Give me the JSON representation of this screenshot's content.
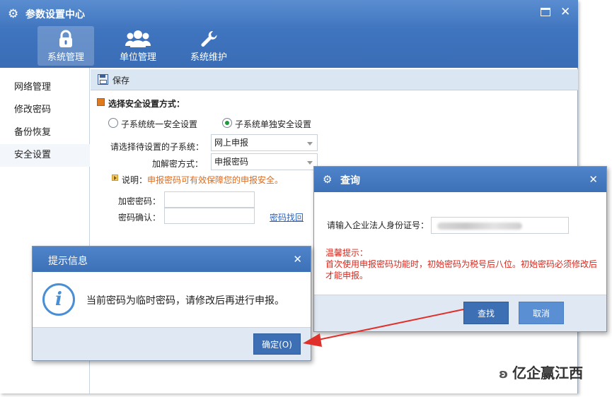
{
  "window": {
    "title": "参数设置中心"
  },
  "nav": [
    {
      "label": "系统管理",
      "icon": "lock-icon",
      "active": true
    },
    {
      "label": "单位管理",
      "icon": "users-icon",
      "active": false
    },
    {
      "label": "系统维护",
      "icon": "wrench-icon",
      "active": false
    }
  ],
  "sidebar": {
    "items": [
      {
        "label": "网络管理"
      },
      {
        "label": "修改密码"
      },
      {
        "label": "备份恢复"
      },
      {
        "label": "安全设置"
      }
    ],
    "active_index": 3
  },
  "toolbar": {
    "save_label": "保存"
  },
  "security": {
    "section_title": "选择安全设置方式：",
    "radio_unified": "子系统统一安全设置",
    "radio_separate": "子系统单独安全设置",
    "selected": "radio_separate",
    "subsystem_label": "请选择待设置的子系统：",
    "subsystem_value": "网上申报",
    "decrypt_label": "加解密方式：",
    "decrypt_value": "申报密码",
    "hint_label": "说明：",
    "hint_text": "申报密码可有效保障您的申报安全。",
    "password_label": "加密密码：",
    "confirm_label": "密码确认：",
    "forgot_link": "密码找回"
  },
  "query_dialog": {
    "title": "查询",
    "id_label": "请输入企业法人身份证号：",
    "tip_title": "温馨提示：",
    "tip_body": "首次使用申报密码功能时，初始密码为税号后八位。初始密码必须修改后才能申报。",
    "search_button": "查找",
    "cancel_button": "取消"
  },
  "info_dialog": {
    "title": "提示信息",
    "message": "当前密码为临时密码，请修改后再进行申报。",
    "ok_button": "确定(O)"
  },
  "watermark": "亿企赢江西",
  "colors": {
    "title_blue": "#3f74be",
    "button_blue": "#3d6fb5",
    "hint_orange": "#e06a1a",
    "warning_red": "#d6281e",
    "arrow_red": "#e0302a"
  }
}
